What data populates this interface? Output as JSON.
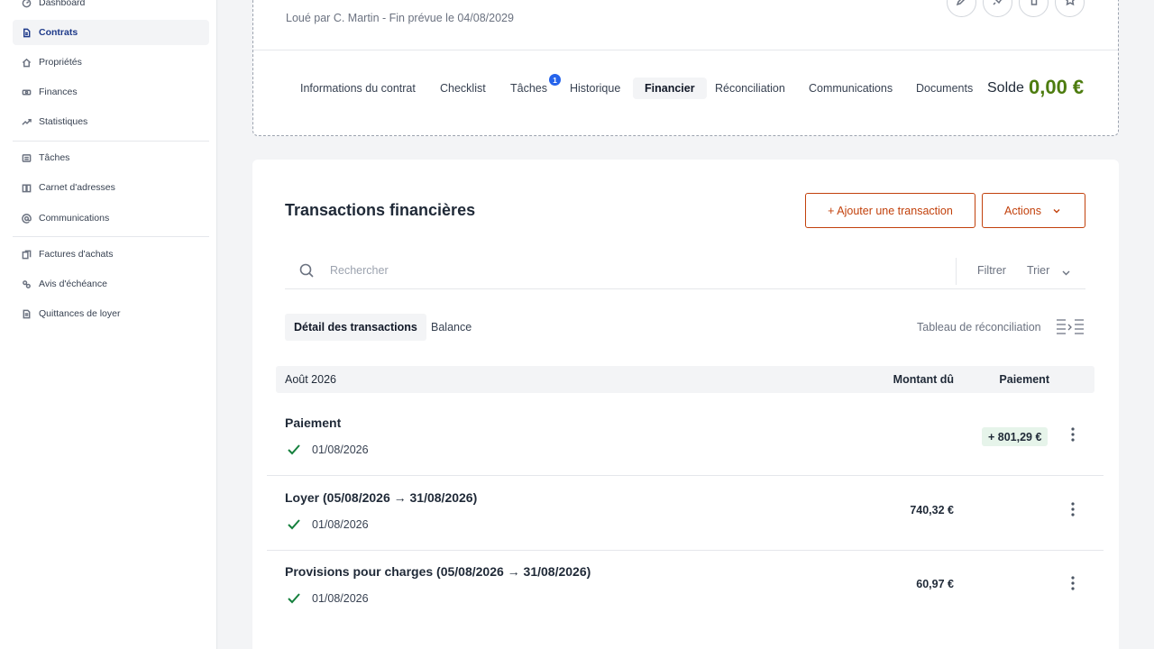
{
  "sidebar": {
    "items": [
      {
        "label": "Dashboard",
        "icon": "dashboard-icon"
      },
      {
        "label": "Contrats",
        "icon": "contract-icon",
        "active": true
      },
      {
        "label": "Propriétés",
        "icon": "home-icon"
      },
      {
        "label": "Finances",
        "icon": "money-icon"
      },
      {
        "label": "Statistiques",
        "icon": "trend-icon"
      },
      {
        "label": "Tâches",
        "icon": "task-list-icon"
      },
      {
        "label": "Carnet d'adresses",
        "icon": "address-book-icon"
      },
      {
        "label": "Communications",
        "icon": "at-icon"
      },
      {
        "label": "Factures d'achats",
        "icon": "invoice-icon"
      },
      {
        "label": "Avis d'échéance",
        "icon": "notice-icon"
      },
      {
        "label": "Quittances de loyer",
        "icon": "receipt-icon"
      }
    ]
  },
  "header": {
    "subtitle": "Loué par C. Martin - Fin prévue le 04/08/2029",
    "actions": [
      "edit-icon",
      "pin-icon",
      "trash-icon",
      "star-icon"
    ],
    "tabs": [
      {
        "label": "Informations du contrat"
      },
      {
        "label": "Checklist"
      },
      {
        "label": "Tâches",
        "badge": "1"
      },
      {
        "label": "Historique"
      },
      {
        "label": "Financier",
        "active": true
      },
      {
        "label": "Réconciliation"
      },
      {
        "label": "Communications"
      },
      {
        "label": "Documents"
      }
    ],
    "balance_label": "Solde",
    "balance_value": "0,00 €",
    "balance_color": "#4d7c0f"
  },
  "main": {
    "title": "Transactions financières",
    "add_button": "+ Ajouter une transaction",
    "actions_button": "Actions",
    "accent_color": "#c2410c",
    "search": {
      "placeholder": "Rechercher",
      "value": ""
    },
    "filter_label": "Filtrer",
    "sort_label": "Trier",
    "subtabs": [
      {
        "label": "Détail des transactions",
        "active": true
      },
      {
        "label": "Balance"
      }
    ],
    "reconciliation_link": "Tableau de réconciliation",
    "table": {
      "month": "Août 2026",
      "col_due": "Montant dû",
      "col_payment": "Paiement",
      "rows": [
        {
          "title": "Paiement",
          "date": "01/08/2026",
          "amount_due": "",
          "payment": "+ 801,29 €"
        },
        {
          "title": "Loyer (05/08/2026 → 31/08/2026)",
          "date": "01/08/2026",
          "amount_due": "740,32 €",
          "payment": ""
        },
        {
          "title": "Provisions pour charges (05/08/2026 → 31/08/2026)",
          "date": "01/08/2026",
          "amount_due": "60,97 €",
          "payment": ""
        }
      ]
    }
  }
}
